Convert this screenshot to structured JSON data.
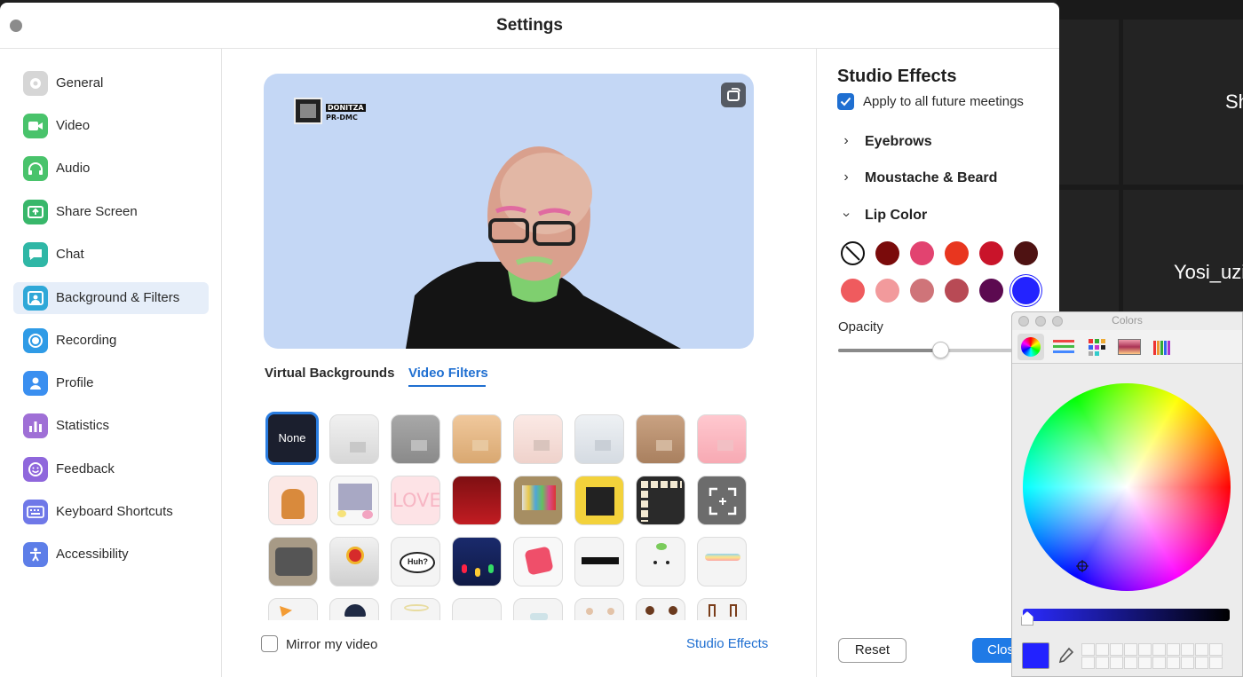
{
  "window": {
    "title": "Settings"
  },
  "sidebar": {
    "items": [
      {
        "label": "General",
        "icon": "gear-icon",
        "color": "#bfbfbf"
      },
      {
        "label": "Video",
        "icon": "video-camera-icon",
        "color": "#49c36b"
      },
      {
        "label": "Audio",
        "icon": "headphones-icon",
        "color": "#49c36b"
      },
      {
        "label": "Share Screen",
        "icon": "share-screen-icon",
        "color": "#38b76a"
      },
      {
        "label": "Chat",
        "icon": "chat-bubble-icon",
        "color": "#2fb7a6"
      },
      {
        "label": "Background & Filters",
        "icon": "person-portrait-icon",
        "color": "#2fa8d8",
        "active": true
      },
      {
        "label": "Recording",
        "icon": "record-icon",
        "color": "#2f9be6"
      },
      {
        "label": "Profile",
        "icon": "person-icon",
        "color": "#3a8ff0"
      },
      {
        "label": "Statistics",
        "icon": "bar-chart-icon",
        "color": "#9f6fd6"
      },
      {
        "label": "Feedback",
        "icon": "smiley-icon",
        "color": "#8f67dc"
      },
      {
        "label": "Keyboard Shortcuts",
        "icon": "keyboard-icon",
        "color": "#6f78e8"
      },
      {
        "label": "Accessibility",
        "icon": "accessibility-icon",
        "color": "#5d7ee8"
      }
    ]
  },
  "preview": {
    "logo_line1": "DONITZA",
    "logo_line2": "PR-DMC"
  },
  "tabs": {
    "virtual": "Virtual Backgrounds",
    "filters": "Video Filters",
    "active": "Video Filters"
  },
  "filters": {
    "none_label": "None",
    "bubble_text": "Huh?",
    "love_text": "LOVE"
  },
  "mirror": {
    "label": "Mirror my video",
    "checked": false
  },
  "studio_effects_link": "Studio Effects",
  "studio": {
    "title": "Studio Effects",
    "apply_label": "Apply to all future meetings",
    "apply_checked": true,
    "sections": [
      {
        "label": "Eyebrows",
        "expanded": false
      },
      {
        "label": "Moustache & Beard",
        "expanded": false
      },
      {
        "label": "Lip Color",
        "expanded": true
      }
    ],
    "lip_colors": [
      "none",
      "#7a0b0b",
      "#e24370",
      "#e8361f",
      "#c9142a",
      "#4e1212",
      "#ef5b5e",
      "#f29a9c",
      "#cf7479",
      "#b84a55",
      "#5c0a50",
      "#2323ff"
    ],
    "selected_color": "#2323ff",
    "opacity_label": "Opacity",
    "opacity_value": 0.46,
    "reset_label": "Reset",
    "close_label": "Close"
  },
  "colors_panel": {
    "title": "Colors",
    "current_color": "#2222ff",
    "brightness_level": 0.0
  },
  "meeting": {
    "participant_1": "Sh",
    "participant_2": "Yosi_uzi"
  }
}
